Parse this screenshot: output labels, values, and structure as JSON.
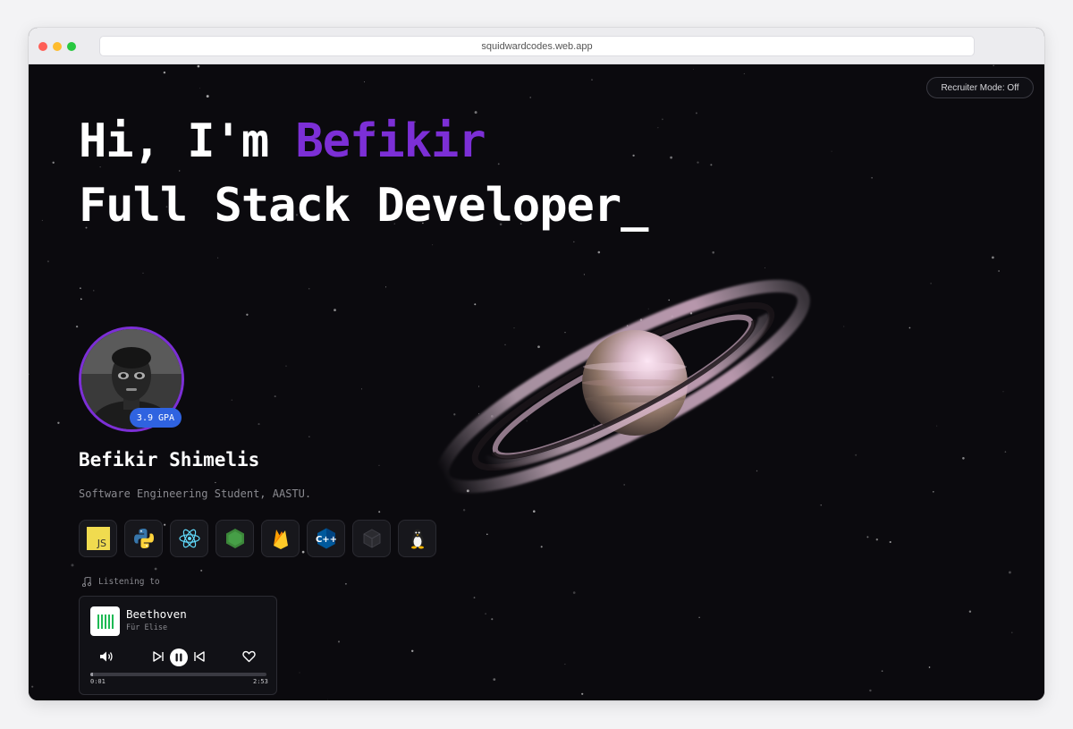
{
  "browser": {
    "url": "squidwardcodes.web.app"
  },
  "header": {
    "recruiter_mode_label": "Recruiter Mode: Off"
  },
  "hero": {
    "greeting": "Hi, I'm ",
    "first_name": "Befikir",
    "role": "Full Stack Developer_"
  },
  "profile": {
    "gpa_badge": "3.9 GPA",
    "name": "Befikir Shimelis",
    "subtitle": "Software Engineering Student, AASTU."
  },
  "skills": [
    {
      "icon": "javascript-icon",
      "label": "JS"
    },
    {
      "icon": "python-icon"
    },
    {
      "icon": "react-icon"
    },
    {
      "icon": "nodejs-icon"
    },
    {
      "icon": "firebase-icon"
    },
    {
      "icon": "cplusplus-icon",
      "label": "C++"
    },
    {
      "icon": "unity-cube-icon"
    },
    {
      "icon": "linux-tux-icon"
    }
  ],
  "now_playing": {
    "label": "Listening to",
    "track": "Beethoven",
    "subtitle": "Für Elise",
    "elapsed": "0:01",
    "duration": "2:53",
    "progress_fraction": 0.006
  },
  "colors": {
    "accent_purple": "#7c2fd6",
    "gpa_blue": "#2f63e0",
    "background": "#0b0a0e"
  }
}
